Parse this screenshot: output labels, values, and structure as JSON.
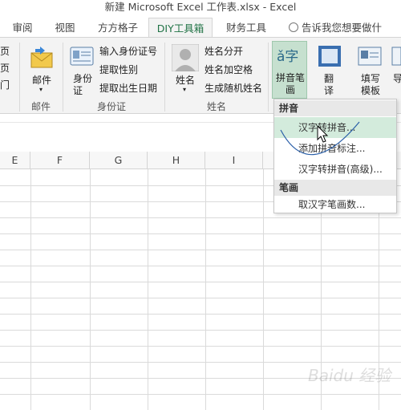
{
  "window": {
    "title": "新建 Microsoft Excel 工作表.xlsx - Excel"
  },
  "tabs": [
    {
      "label": "审阅"
    },
    {
      "label": "视图"
    },
    {
      "label": "方方格子"
    },
    {
      "label": "DIY工具箱"
    },
    {
      "label": "财务工具"
    }
  ],
  "tell_me": "告诉我您想要做什么...",
  "ribbon": {
    "left_partial": [
      "页",
      "页",
      "门"
    ],
    "mail": {
      "label": "邮件",
      "group": "邮件"
    },
    "idcard": {
      "big_label": "身份证",
      "items": [
        "输入身份证号",
        "提取性别",
        "提取出生日期"
      ],
      "group": "身份证"
    },
    "name": {
      "big_label": "姓名",
      "items": [
        "姓名分开",
        "姓名加空格",
        "生成随机姓名"
      ],
      "group": "姓名"
    },
    "pinyin_btn": {
      "glyph": "ǎ字",
      "label": "拼音笔画"
    },
    "translate_btn": {
      "label": "翻译"
    },
    "template_btn": {
      "label": "填写模板"
    },
    "cut_btn": {
      "label": "导"
    }
  },
  "dropdown": {
    "section1": "拼音",
    "items1": [
      "汉字转拼音...",
      "添加拼音标注...",
      "汉字转拼音(高级)..."
    ],
    "section2": "笔画",
    "items2": [
      "取汉字笔画数..."
    ]
  },
  "columns": [
    "E",
    "F",
    "G",
    "H",
    "I"
  ],
  "watermark": "Baidu 经验"
}
